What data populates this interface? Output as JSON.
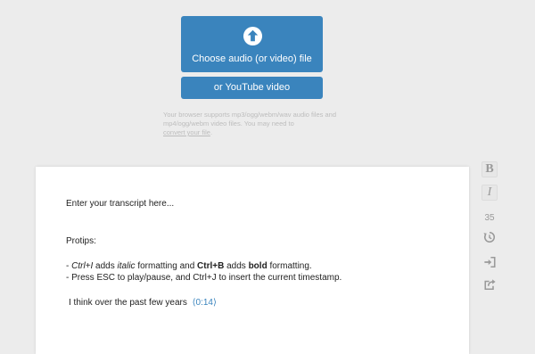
{
  "upload": {
    "choose_label": "Choose audio (or video) file",
    "youtube_label": "or YouTube video",
    "support_text": "Your browser supports mp3/ogg/webm/wav audio files and mp4/ogg/webm video files. You may need to",
    "convert_link": "convert your file",
    "support_end": "."
  },
  "editor": {
    "line1": "Enter your transcript here...",
    "protips_heading": "Protips:",
    "tip1": {
      "dash": "- ",
      "ctrl_i": "Ctrl+I",
      "adds1": " adds ",
      "italic": "italic",
      "mid": " formatting and ",
      "ctrl_b": "Ctrl+B",
      "adds2": " adds ",
      "bold": "bold",
      "end": " formatting."
    },
    "tip2": "- Press ESC to play/pause, and Ctrl+J to insert the current timestamp.",
    "transcript_text": "I think over the past few years",
    "timestamp": "0:14"
  },
  "sidebar": {
    "bold_label": "B",
    "italic_label": "I",
    "speed_value": "35"
  },
  "colors": {
    "accent": "#3a84bd",
    "background": "#ececec"
  },
  "icons": [
    "upload-icon",
    "history-icon",
    "import-icon",
    "export-icon"
  ]
}
